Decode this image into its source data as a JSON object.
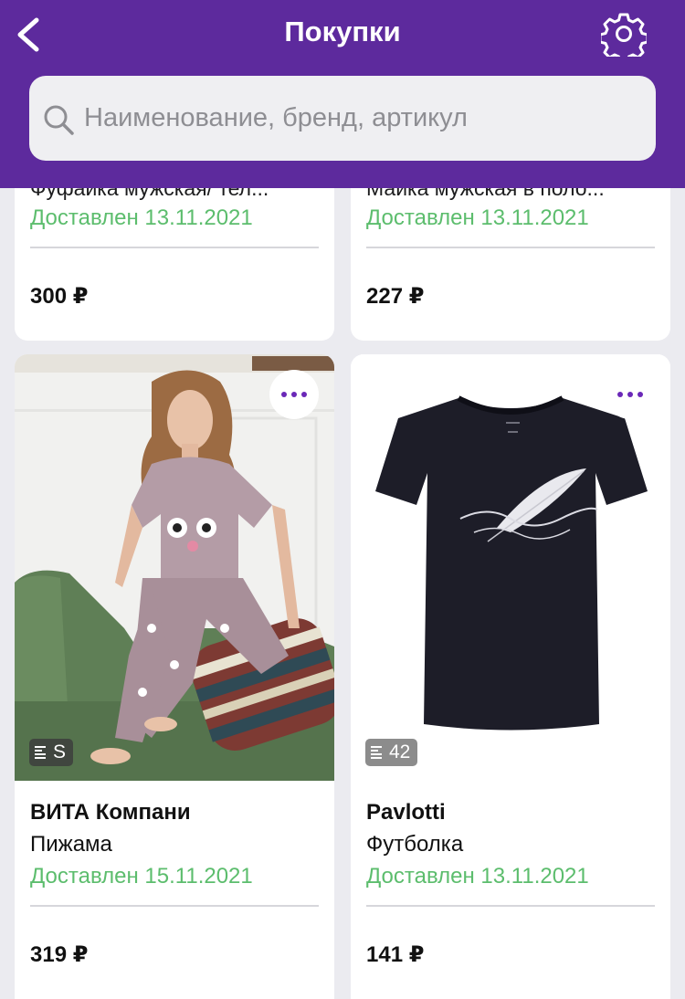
{
  "header": {
    "title": "Покупки",
    "search_placeholder": "Наименование, бренд, артикул"
  },
  "purchases": [
    {
      "name": "Фуфайка мужская/ тел...",
      "status": "Доставлен 13.11.2021",
      "price": "300 ₽"
    },
    {
      "name": "Майка мужская в поло...",
      "status": "Доставлен 13.11.2021",
      "price": "227 ₽"
    },
    {
      "brand": "ВИТА Компани",
      "type": "Пижама",
      "status": "Доставлен 15.11.2021",
      "price": "319 ₽",
      "size": "S",
      "image": "woman-in-pajamas-photo"
    },
    {
      "brand": "Pavlotti",
      "type": "Футболка",
      "status": "Доставлен 13.11.2021",
      "price": "141 ₽",
      "size": "42",
      "image": "black-tshirt-photo"
    }
  ],
  "colors": {
    "header_bg": "#5d2a9d",
    "status_green": "#5cbd6d",
    "accent_purple": "#6b28b8",
    "page_bg": "#ebebf0"
  },
  "icons": [
    "chevron-left-icon",
    "gear-icon",
    "search-icon",
    "more-dots-icon",
    "size-list-icon"
  ]
}
